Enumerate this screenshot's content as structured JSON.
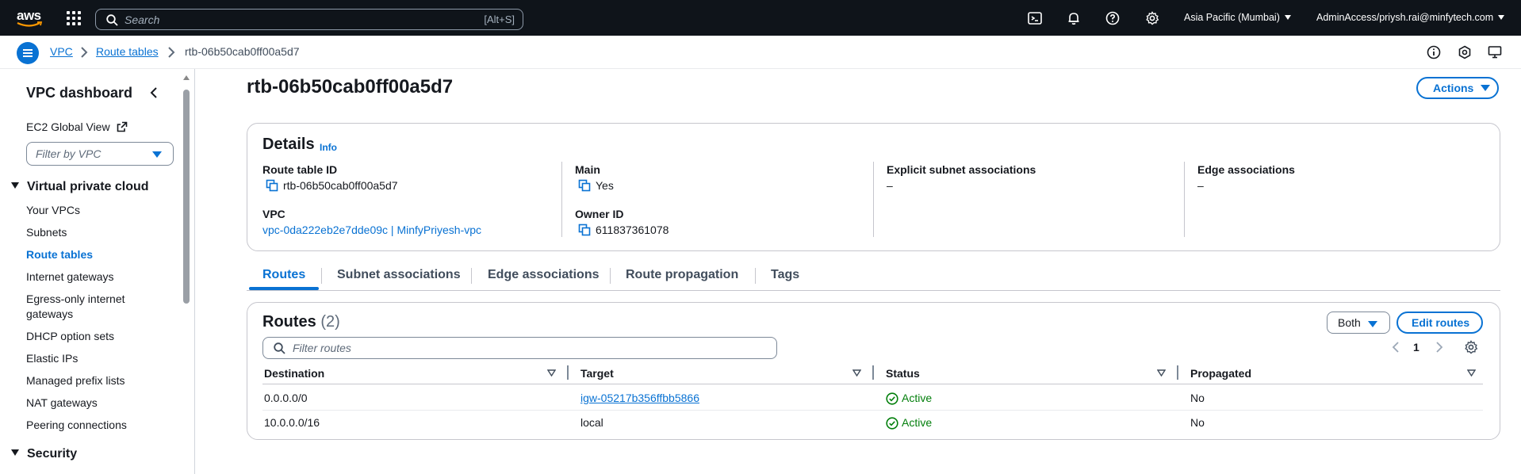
{
  "topbar": {
    "logo_text": "aws",
    "search_placeholder": "Search",
    "search_shortcut": "[Alt+S]",
    "region": "Asia Pacific (Mumbai)",
    "account": "AdminAccess/priysh.rai@minfytech.com"
  },
  "breadcrumb": {
    "items": [
      "VPC",
      "Route tables",
      "rtb-06b50cab0ff00a5d7"
    ]
  },
  "sidebar": {
    "title": "VPC dashboard",
    "ec2_global_view": "EC2 Global View",
    "filter_placeholder": "Filter by VPC",
    "section_vpc": "Virtual private cloud",
    "items": [
      "Your VPCs",
      "Subnets",
      "Route tables",
      "Internet gateways",
      "Egress-only internet",
      "gateways",
      "DHCP option sets",
      "Elastic IPs",
      "Managed prefix lists",
      "NAT gateways",
      "Peering connections"
    ],
    "active_item": "Route tables",
    "section_security": "Security"
  },
  "page": {
    "title": "rtb-06b50cab0ff00a5d7",
    "actions_label": "Actions"
  },
  "details": {
    "heading": "Details",
    "info": "Info",
    "route_table_id_label": "Route table ID",
    "route_table_id": "rtb-06b50cab0ff00a5d7",
    "main_label": "Main",
    "main": "Yes",
    "explicit_subnet_label": "Explicit subnet associations",
    "explicit_subnet": "–",
    "edge_assoc_label": "Edge associations",
    "edge_assoc": "–",
    "vpc_label": "VPC",
    "vpc": "vpc-0da222eb2e7dde09c | MinfyPriyesh-vpc",
    "owner_label": "Owner ID",
    "owner": "611837361078"
  },
  "tabs": [
    "Routes",
    "Subnet associations",
    "Edge associations",
    "Route propagation",
    "Tags"
  ],
  "routes": {
    "heading": "Routes",
    "count": "(2)",
    "both_label": "Both",
    "edit_label": "Edit routes",
    "filter_placeholder": "Filter routes",
    "page": "1",
    "columns": [
      "Destination",
      "Target",
      "Status",
      "Propagated"
    ],
    "rows": [
      {
        "destination": "0.0.0.0/0",
        "target": "igw-05217b356ffbb5866",
        "status": "Active",
        "propagated": "No"
      },
      {
        "destination": "10.0.0.0/16",
        "target": "local",
        "status": "Active",
        "propagated": "No"
      }
    ]
  },
  "colors": {
    "accent": "#0972d3",
    "success": "#037f0c",
    "topbar": "#0f141a"
  }
}
